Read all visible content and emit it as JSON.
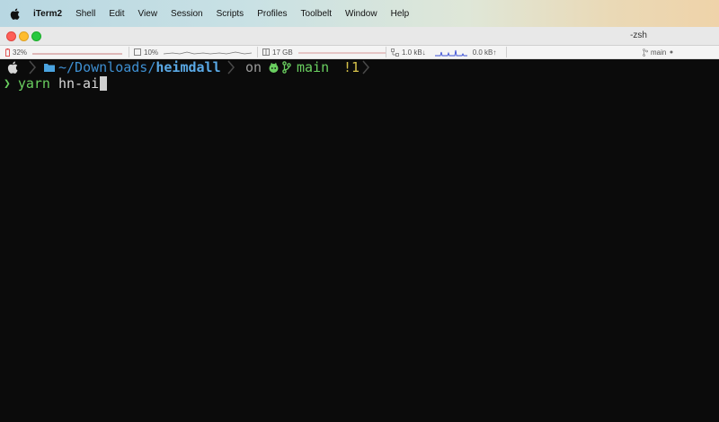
{
  "menubar": {
    "app": "iTerm2",
    "items": [
      "Shell",
      "Edit",
      "View",
      "Session",
      "Scripts",
      "Profiles",
      "Toolbelt",
      "Window",
      "Help"
    ]
  },
  "window": {
    "title": "-zsh"
  },
  "statusbar": {
    "battery": "32%",
    "cpu": "10%",
    "memory": "17 GB",
    "net_down": "1.0 kB↓",
    "net_up": "0.0 kB↑",
    "git_branch": "main"
  },
  "prompt": {
    "path_prefix": "~/Downloads/",
    "path_dir": "heimdall",
    "on": "on",
    "branch": "main",
    "git_status": "!1"
  },
  "command": {
    "caret": "❯",
    "program": "yarn",
    "args": "hn-ai"
  }
}
